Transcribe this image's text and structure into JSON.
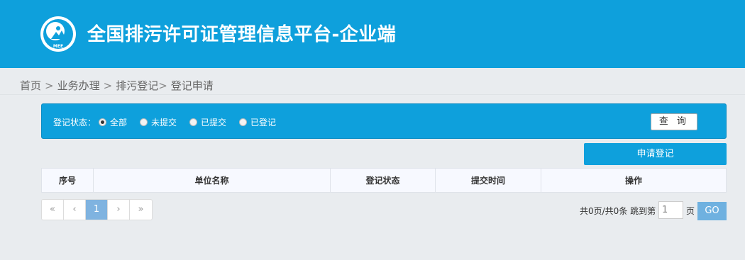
{
  "header": {
    "logo_icon": "mee-emblem-icon",
    "logo_text": "MEE",
    "title": "全国排污许可证管理信息平台-企业端",
    "bg_color": "#0ea0dc"
  },
  "breadcrumb": {
    "items": [
      "首页",
      "业务办理",
      "排污登记",
      "登记申请"
    ],
    "separators": [
      ">",
      ">",
      ">"
    ]
  },
  "filter": {
    "label": "登记状态：",
    "options": [
      "全部",
      "未提交",
      "已提交",
      "已登记"
    ],
    "selected": "全部",
    "query_label": "查 询"
  },
  "apply_button_label": "申请登记",
  "table": {
    "columns": [
      "序号",
      "单位名称",
      "登记状态",
      "提交时间",
      "操作"
    ],
    "rows": []
  },
  "pagination": {
    "first": "«",
    "prev": "‹",
    "current": "1",
    "next": "›",
    "last": "»",
    "summary": "共0页/共0条",
    "jump_label": "跳到第",
    "jump_value": "1",
    "page_unit": "页",
    "go_label": "GO"
  }
}
